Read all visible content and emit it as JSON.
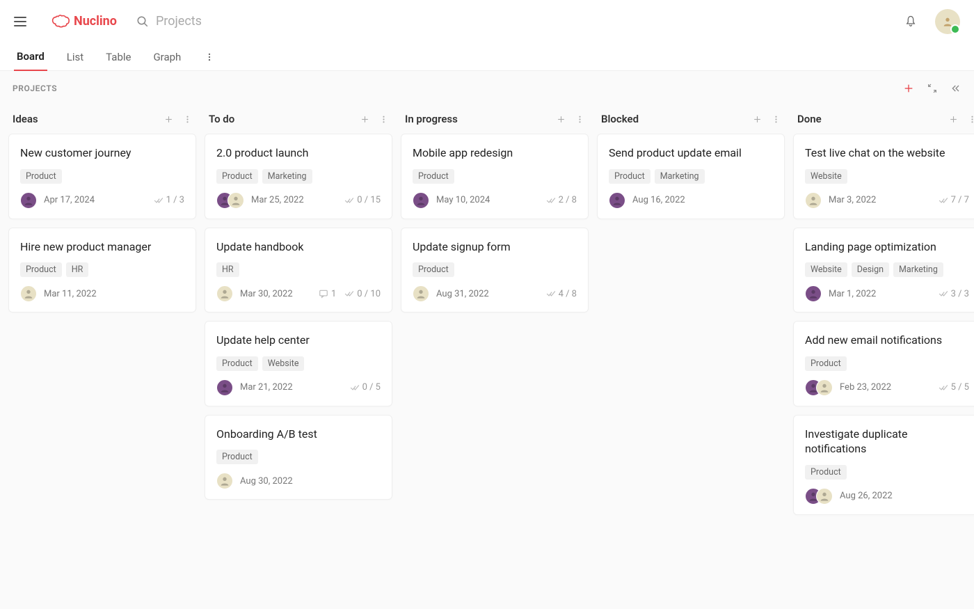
{
  "brand": {
    "name": "Nuclino"
  },
  "search": {
    "placeholder": "Projects"
  },
  "tabs": [
    "Board",
    "List",
    "Table",
    "Graph"
  ],
  "activeTab": 0,
  "board": {
    "title": "PROJECTS"
  },
  "columns": [
    {
      "title": "Ideas",
      "cards": [
        {
          "title": "New customer journey",
          "tags": [
            "Product"
          ],
          "avatars": [
            "a1"
          ],
          "date": "Apr 17, 2024",
          "checks": "1 / 3"
        },
        {
          "title": "Hire new product manager",
          "tags": [
            "Product",
            "HR"
          ],
          "avatars": [
            "a2"
          ],
          "date": "Mar 11, 2022"
        }
      ]
    },
    {
      "title": "To do",
      "cards": [
        {
          "title": "2.0 product launch",
          "tags": [
            "Product",
            "Marketing"
          ],
          "avatars": [
            "a1",
            "a2"
          ],
          "date": "Mar 25, 2022",
          "checks": "0 / 15"
        },
        {
          "title": "Update handbook",
          "tags": [
            "HR"
          ],
          "avatars": [
            "a2"
          ],
          "date": "Mar 30, 2022",
          "comments": "1",
          "checks": "0 / 10"
        },
        {
          "title": "Update help center",
          "tags": [
            "Product",
            "Website"
          ],
          "avatars": [
            "a1"
          ],
          "date": "Mar 21, 2022",
          "checks": "0 / 5"
        },
        {
          "title": "Onboarding A/B test",
          "tags": [
            "Product"
          ],
          "avatars": [
            "a2"
          ],
          "date": "Aug 30, 2022"
        }
      ]
    },
    {
      "title": "In progress",
      "cards": [
        {
          "title": "Mobile app redesign",
          "tags": [
            "Product"
          ],
          "avatars": [
            "a1"
          ],
          "date": "May 10, 2024",
          "checks": "2 / 8"
        },
        {
          "title": "Update signup form",
          "tags": [
            "Product"
          ],
          "avatars": [
            "a2"
          ],
          "date": "Aug 31, 2022",
          "checks": "4 / 8"
        }
      ]
    },
    {
      "title": "Blocked",
      "cards": [
        {
          "title": "Send product update email",
          "tags": [
            "Product",
            "Marketing"
          ],
          "avatars": [
            "a1"
          ],
          "date": "Aug 16, 2022"
        }
      ]
    },
    {
      "title": "Done",
      "cards": [
        {
          "title": "Test live chat on the website",
          "tags": [
            "Website"
          ],
          "avatars": [
            "a2"
          ],
          "date": "Mar 3, 2022",
          "checks": "7 / 7"
        },
        {
          "title": "Landing page optimization",
          "tags": [
            "Website",
            "Design",
            "Marketing"
          ],
          "avatars": [
            "a1"
          ],
          "date": "Mar 1, 2022",
          "checks": "3 / 3"
        },
        {
          "title": "Add new email notifications",
          "tags": [
            "Product"
          ],
          "avatars": [
            "a1",
            "a2"
          ],
          "date": "Feb 23, 2022",
          "checks": "5 / 5"
        },
        {
          "title": "Investigate duplicate notifications",
          "tags": [
            "Product"
          ],
          "avatars": [
            "a1",
            "a2"
          ],
          "date": "Aug 26, 2022"
        }
      ]
    }
  ]
}
